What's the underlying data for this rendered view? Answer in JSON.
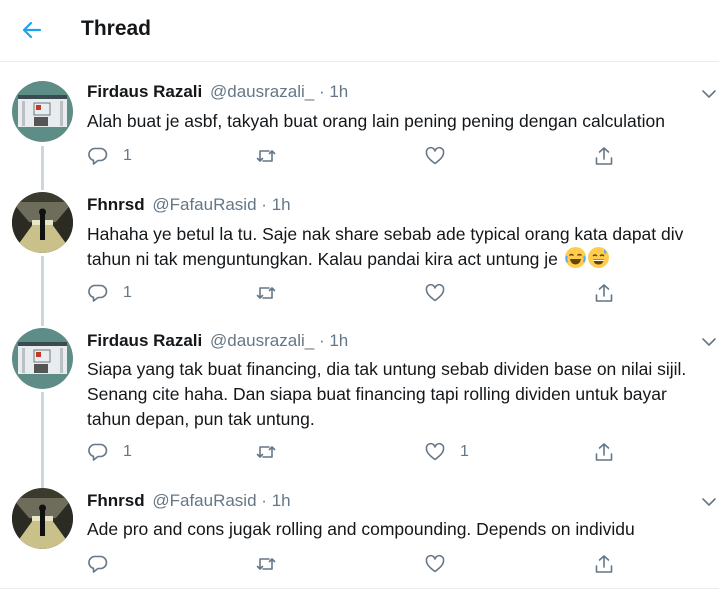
{
  "header": {
    "title": "Thread"
  },
  "tweets": [
    {
      "name": "Firdaus Razali",
      "handle": "@dausrazali_",
      "sep": "·",
      "time": "1h",
      "text": "Alah buat je asbf, takyah buat orang lain pening pening dengan calculation",
      "reply_count": "1",
      "retweet_count": "",
      "like_count": ""
    },
    {
      "name": "Fhnrsd",
      "handle": "@FafauRasid",
      "sep": "·",
      "time": "1h",
      "text_line1": "Hahaha ye betul la tu. Saje nak share sebab ade typical orang kata dapat div",
      "text_line2": "tahun ni tak menguntungkan. Kalau pandai kira act untung je",
      "emojis": [
        "face-with-tears-of-joy",
        "grinning-face-with-sweat"
      ],
      "reply_count": "1",
      "retweet_count": "",
      "like_count": ""
    },
    {
      "name": "Firdaus Razali",
      "handle": "@dausrazali_",
      "sep": "·",
      "time": "1h",
      "text": "Siapa yang tak buat financing, dia tak untung sebab dividen base on nilai sijil. Senang cite haha. Dan siapa buat financing tapi rolling dividen untuk bayar tahun depan, pun tak untung.",
      "reply_count": "1",
      "retweet_count": "",
      "like_count": "1"
    },
    {
      "name": "Fhnrsd",
      "handle": "@FafauRasid",
      "sep": "·",
      "time": "1h",
      "text": "Ade pro and cons jugak rolling and compounding. Depends on individu",
      "reply_count": "",
      "retweet_count": "",
      "like_count": ""
    }
  ],
  "colors": {
    "accent": "#1da1f2",
    "text": "#14171a",
    "secondary": "#657786",
    "thread_line": "#ccd6dd",
    "divider": "#e6ecf0"
  }
}
